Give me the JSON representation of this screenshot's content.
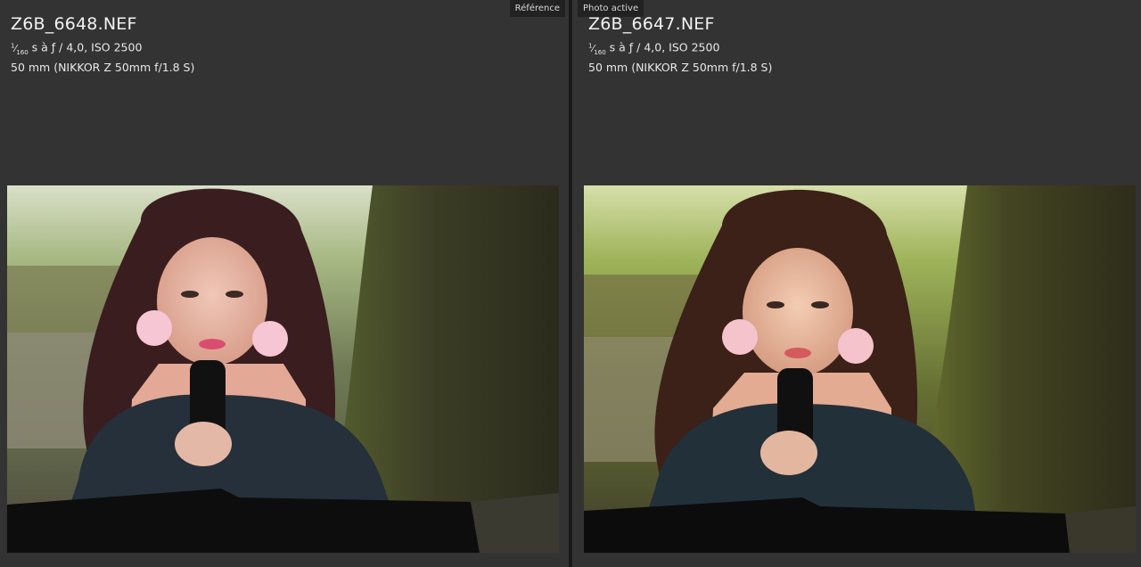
{
  "panes": {
    "left": {
      "label": "Référence",
      "filename": "Z6B_6648.NEF",
      "shutter_numerator": "1",
      "shutter_denominator": "160",
      "exposure_rest": "s à ƒ / 4,0, ISO 2500",
      "lens": "50 mm (NIKKOR Z 50mm f/1.8 S)"
    },
    "right": {
      "label": "Photo active",
      "filename": "Z6B_6647.NEF",
      "shutter_numerator": "1",
      "shutter_denominator": "160",
      "exposure_rest": "s à ƒ / 4,0, ISO 2500",
      "lens": "50 mm (NIKKOR Z 50mm f/1.8 S)"
    }
  },
  "colors": {
    "background": "#323232",
    "divider": "#1a1a1a",
    "label_bg": "#222222"
  }
}
